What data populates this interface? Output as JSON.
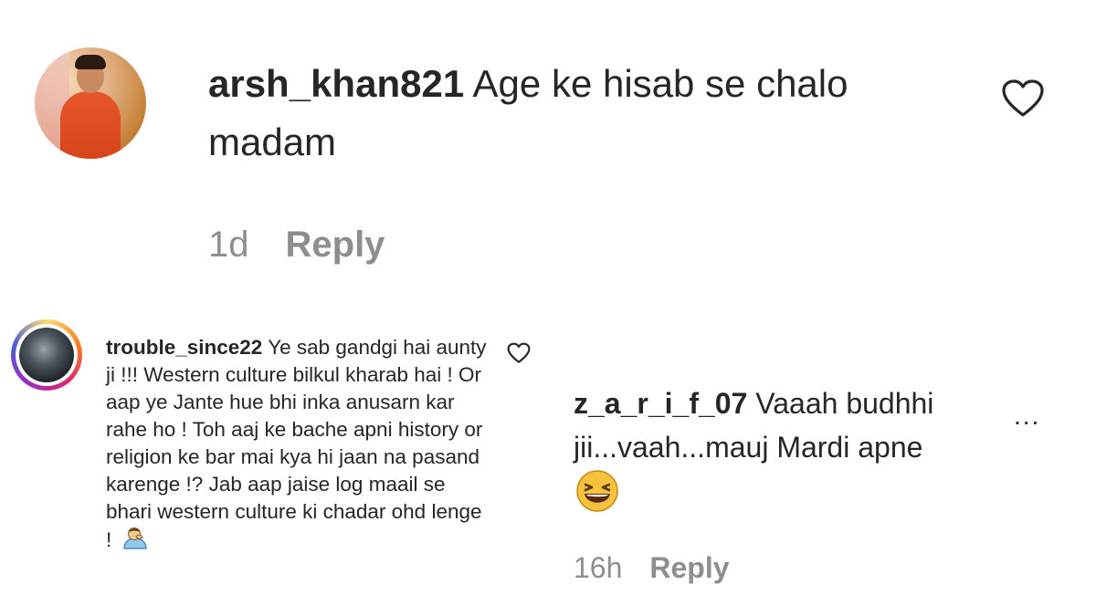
{
  "comment1": {
    "username": "arsh_khan821",
    "text": "Age ke hisab se chalo madam",
    "time": "1d",
    "reply_label": "Reply",
    "avatar_icon": "user-avatar",
    "like_icon": "heart-outline-icon"
  },
  "comment2": {
    "username": "trouble_since22",
    "text": "Ye sab gandgi hai aunty ji !!! Western culture bilkul kharab hai ! Or aap ye Jante hue bhi inka anusarn kar rahe ho ! Toh aaj ke bache apni history or religion ke bar mai kya hi jaan na pasand karenge !? Jab aap jaise log maail se bhari western culture ki chadar ohd lenge !",
    "trailing_emoji": "person-facepalming-emoji",
    "avatar_icon": "user-avatar-story-ring",
    "like_icon": "heart-outline-icon"
  },
  "comment3": {
    "username": "z_a_r_i_f_07",
    "text_line1": "Vaaah budhhi",
    "text_line2": "jii...vaah...mauj Mardi apne",
    "trailing_emoji": "grinning-squinting-face-emoji",
    "more_label": "...",
    "time": "16h",
    "reply_label": "Reply"
  }
}
